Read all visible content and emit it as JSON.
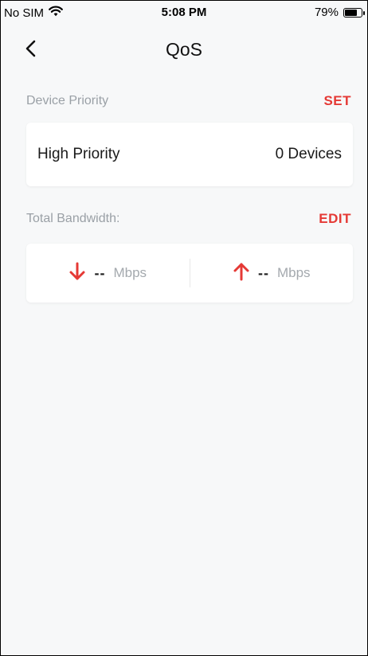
{
  "status_bar": {
    "carrier": "No SIM",
    "time": "5:08 PM",
    "battery_percent_label": "79%",
    "battery_level": 0.79
  },
  "nav": {
    "title": "QoS"
  },
  "device_priority": {
    "label": "Device Priority",
    "action": "SET",
    "row_label": "High Priority",
    "row_value": "0 Devices"
  },
  "bandwidth": {
    "label": "Total Bandwidth:",
    "action": "EDIT",
    "download": {
      "value": "--",
      "unit": "Mbps"
    },
    "upload": {
      "value": "--",
      "unit": "Mbps"
    }
  },
  "colors": {
    "accent": "#e53935",
    "muted_text": "#9aa0a6",
    "background": "#f7f8f9"
  }
}
